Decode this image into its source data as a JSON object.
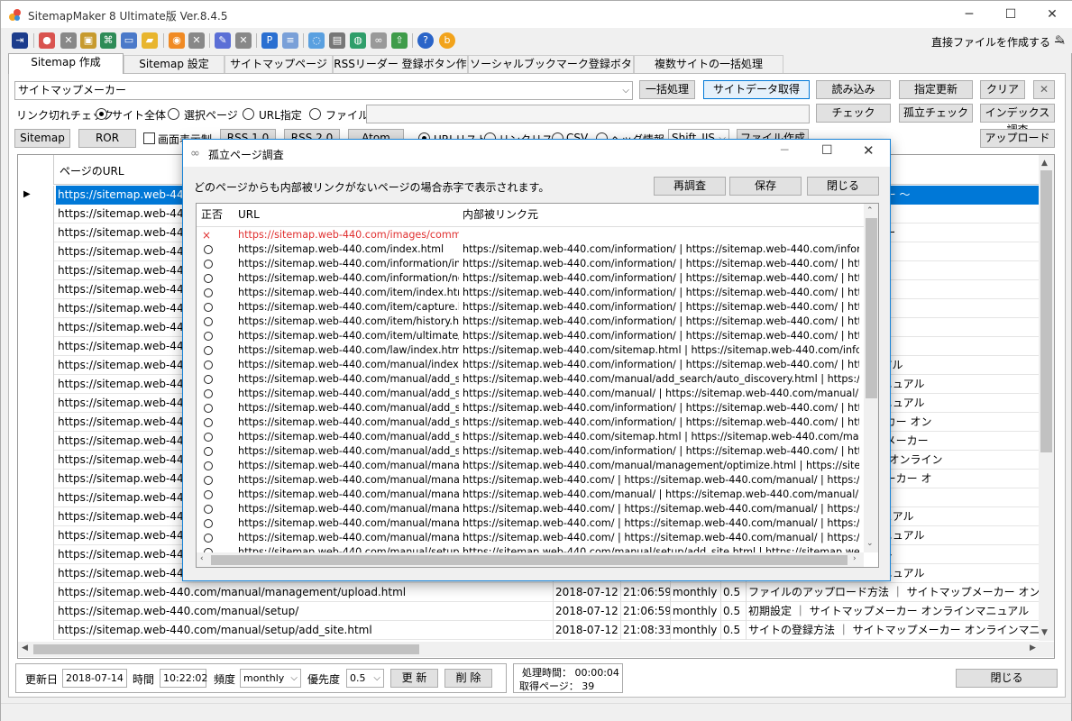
{
  "app": {
    "title": "SitemapMaker 8 Ultimate版  Ver.8.4.5",
    "direct_file_label": "直接ファイルを作成する ー"
  },
  "window_controls": {
    "minimize": "─",
    "maximize": "☐",
    "close": "✕"
  },
  "tabs": [
    {
      "label": "Sitemap 作成"
    },
    {
      "label": "Sitemap 設定"
    },
    {
      "label": "サイトマップページ作成"
    },
    {
      "label": "RSSリーダー 登録ボタン作成"
    },
    {
      "label": "ソーシャルブックマーク登録ボタン作成"
    },
    {
      "label": "複数サイトの一括処理"
    }
  ],
  "main": {
    "site_combo_value": "サイトマップメーカー",
    "batch_button": "一括処理",
    "get_site_data_button": "サイトデータ取得",
    "load_button": "読み込み",
    "update_button": "指定更新",
    "clear_button": "クリア",
    "link_check_label": "リンク切れチェック",
    "radio_whole_site": "サイト全体",
    "radio_selected_page": "選択ページ",
    "radio_url": "URL指定",
    "radio_file": "ファイル",
    "check_button": "チェック",
    "orphan_check_button": "孤立チェック",
    "index_check_button": "インデックス調査",
    "sitemap_button": "Sitemap",
    "ror_button": "ROR",
    "screen_display_label": "画面表示制",
    "rss10_button": "RSS 1.0",
    "rss20_button": "RSS 2.0",
    "atom_button": "Atom",
    "url_list_label": "URLリスト",
    "link_list_label": "リンクリスト",
    "csv_label": "CSV",
    "header_info_label": "ヘッダ情報",
    "encoding_value": "Shift_JIS",
    "file_create_button": "ファイル作成",
    "upload_button": "アップロード"
  },
  "grid": {
    "header_url": "ページのURL",
    "rows": [
      {
        "url": "https://sitemap.web-440.c",
        "date": "",
        "time": "",
        "freq": "",
        "prio": "",
        "title": "ット 〜 サイトマップメーカー 〜",
        "selected": true
      },
      {
        "url": "https://sitemap.web-440.c",
        "date": "",
        "time": "",
        "freq": "",
        "prio": "",
        "title": ""
      },
      {
        "url": "https://sitemap.web-440.c",
        "date": "",
        "time": "",
        "freq": "",
        "prio": "",
        "title": "いて ｜ サイトマップメーカー"
      },
      {
        "url": "https://sitemap.web-440.c",
        "date": "",
        "time": "",
        "freq": "",
        "prio": "",
        "title": "プメーカー"
      },
      {
        "url": "https://sitemap.web-440.c",
        "date": "",
        "time": "",
        "freq": "",
        "prio": "",
        "title": "プメーカー"
      },
      {
        "url": "https://sitemap.web-440.c",
        "date": "",
        "time": "",
        "freq": "",
        "prio": "",
        "title": "カー"
      },
      {
        "url": "https://sitemap.web-440.c",
        "date": "",
        "time": "",
        "freq": "",
        "prio": "",
        "title": ""
      },
      {
        "url": "https://sitemap.web-440.c",
        "date": "",
        "time": "",
        "freq": "",
        "prio": "",
        "title": "ー"
      },
      {
        "url": "https://sitemap.web-440.c",
        "date": "",
        "time": "",
        "freq": "",
        "prio": "",
        "title": "トマップメーカー"
      },
      {
        "url": "https://sitemap.web-440.c",
        "date": "",
        "time": "",
        "freq": "",
        "prio": "",
        "title": "メーカー オンラインマニュアル"
      },
      {
        "url": "https://sitemap.web-440.c",
        "date": "",
        "time": "",
        "freq": "",
        "prio": "",
        "title": "ップメーカー オンラインマニュアル"
      },
      {
        "url": "https://sitemap.web-440.c",
        "date": "",
        "time": "",
        "freq": "",
        "prio": "",
        "title": "ップメーカー オンラインマニュアル"
      },
      {
        "url": "https://sitemap.web-440.c",
        "date": "",
        "time": "",
        "freq": "",
        "prio": "",
        "title": "録方法 ｜ サイトマップメーカー オン"
      },
      {
        "url": "https://sitemap.web-440.c",
        "date": "",
        "time": "",
        "freq": "",
        "prio": "",
        "title": "の登録方法 ｜ サイトマップメーカー"
      },
      {
        "url": "https://sitemap.web-440.c",
        "date": "",
        "time": "",
        "freq": "",
        "prio": "",
        "title": "法 ｜ サイトマップメーカー オンライン"
      },
      {
        "url": "https://sitemap.web-440.c",
        "date": "",
        "time": "",
        "freq": "",
        "prio": "",
        "title": "登録方法 ｜ サイトマップメーカー オ"
      },
      {
        "url": "https://sitemap.web-440.c",
        "date": "",
        "time": "",
        "freq": "",
        "prio": "",
        "title": "カー オンラインマニュアル"
      },
      {
        "url": "https://sitemap.web-440.c",
        "date": "",
        "time": "",
        "freq": "",
        "prio": "",
        "title": "プメーカー オンラインマニュアル"
      },
      {
        "url": "https://sitemap.web-440.c",
        "date": "",
        "time": "",
        "freq": "",
        "prio": "",
        "title": "ップメーカー オンラインマニュアル"
      },
      {
        "url": "https://sitemap.web-440.c",
        "date": "",
        "time": "",
        "freq": "",
        "prio": "",
        "title": "ーカー オンラインマニュアル"
      },
      {
        "url": "https://sitemap.web-440.c",
        "date": "",
        "time": "",
        "freq": "",
        "prio": "",
        "title": "ップメーカー オンラインマニュアル"
      },
      {
        "url": "https://sitemap.web-440.com/manual/management/upload.html",
        "date": "2018-07-12",
        "time": "21:06:59",
        "freq": "monthly",
        "prio": "0.5",
        "title": "ファイルのアップロード方法 ｜ サイトマップメーカー オンラインマニュアル"
      },
      {
        "url": "https://sitemap.web-440.com/manual/setup/",
        "date": "2018-07-12",
        "time": "21:06:59",
        "freq": "monthly",
        "prio": "0.5",
        "title": "初期設定 ｜ サイトマップメーカー オンラインマニュアル"
      },
      {
        "url": "https://sitemap.web-440.com/manual/setup/add_site.html",
        "date": "2018-07-12",
        "time": "21:08:33",
        "freq": "monthly",
        "prio": "0.5",
        "title": "サイトの登録方法 ｜ サイトマップメーカー オンラインマニュアル"
      }
    ]
  },
  "bottom": {
    "updated_label": "更新日",
    "updated_value": "2018-07-14",
    "time_label": "時間",
    "time_value": "10:22:02",
    "freq_label": "頻度",
    "freq_value": "monthly",
    "priority_label": "優先度",
    "priority_value": "0.5",
    "update_button": "更 新",
    "delete_button": "削 除",
    "process_time": "処理時間： 00:00:04",
    "pages_fetched": "取得ページ： 39",
    "close_button": "閉じる"
  },
  "dialog": {
    "title": "孤立ページ調査",
    "info": "どのページからも内部被リンクがないページの場合赤字で表示されます。",
    "rescan_button": "再調査",
    "save_button": "保存",
    "close_button": "閉じる",
    "col_status": "正否",
    "col_url": "URL",
    "col_source": "内部被リンク元",
    "rows": [
      {
        "ok": false,
        "url": "https://sitemap.web-440.com/images/comm...",
        "source": ""
      },
      {
        "ok": true,
        "url": "https://sitemap.web-440.com/index.html",
        "source": "https://sitemap.web-440.com/information/ | https://sitemap.web-440.com/informati..."
      },
      {
        "ok": true,
        "url": "https://sitemap.web-440.com/information/in...",
        "source": "https://sitemap.web-440.com/information/ | https://sitemap.web-440.com/ | https:/..."
      },
      {
        "ok": true,
        "url": "https://sitemap.web-440.com/information/no...",
        "source": "https://sitemap.web-440.com/information/ | https://sitemap.web-440.com/ | https:/..."
      },
      {
        "ok": true,
        "url": "https://sitemap.web-440.com/item/index.html",
        "source": "https://sitemap.web-440.com/information/ | https://sitemap.web-440.com/ | https:/..."
      },
      {
        "ok": true,
        "url": "https://sitemap.web-440.com/item/capture.h",
        "source": "https://sitemap.web-440.com/information/ | https://sitemap.web-440.com/ | https:/..."
      },
      {
        "ok": true,
        "url": "https://sitemap.web-440.com/item/history.ht",
        "source": "https://sitemap.web-440.com/information/ | https://sitemap.web-440.com/ | https:/..."
      },
      {
        "ok": true,
        "url": "https://sitemap.web-440.com/item/ultimate/...",
        "source": "https://sitemap.web-440.com/information/ | https://sitemap.web-440.com/ | https:/..."
      },
      {
        "ok": true,
        "url": "https://sitemap.web-440.com/law/index.html",
        "source": "https://sitemap.web-440.com/sitemap.html | https://sitemap.web-440.com/informati..."
      },
      {
        "ok": true,
        "url": "https://sitemap.web-440.com/manual/index.h",
        "source": "https://sitemap.web-440.com/information/ | https://sitemap.web-440.com/ | https:/..."
      },
      {
        "ok": true,
        "url": "https://sitemap.web-440.com/manual/add_se...",
        "source": "https://sitemap.web-440.com/manual/add_search/auto_discovery.html | https://site..."
      },
      {
        "ok": true,
        "url": "https://sitemap.web-440.com/manual/add_se...",
        "source": "https://sitemap.web-440.com/manual/ | https://sitemap.web-440.com/manual/ | htt..."
      },
      {
        "ok": true,
        "url": "https://sitemap.web-440.com/manual/add_se...",
        "source": "https://sitemap.web-440.com/information/ | https://sitemap.web-440.com/ | https:/..."
      },
      {
        "ok": true,
        "url": "https://sitemap.web-440.com/manual/add_se...",
        "source": "https://sitemap.web-440.com/information/ | https://sitemap.web-440.com/ | https:/..."
      },
      {
        "ok": true,
        "url": "https://sitemap.web-440.com/manual/add_se...",
        "source": "https://sitemap.web-440.com/sitemap.html | https://sitemap.web-440.com/manual/..."
      },
      {
        "ok": true,
        "url": "https://sitemap.web-440.com/manual/add_se...",
        "source": "https://sitemap.web-440.com/information/ | https://sitemap.web-440.com/ | https:/..."
      },
      {
        "ok": true,
        "url": "https://sitemap.web-440.com/manual/manage...",
        "source": "https://sitemap.web-440.com/manual/management/optimize.html | https://sitemap...."
      },
      {
        "ok": true,
        "url": "https://sitemap.web-440.com/manual/manage...",
        "source": "https://sitemap.web-440.com/ | https://sitemap.web-440.com/manual/ | https://sit..."
      },
      {
        "ok": true,
        "url": "https://sitemap.web-440.com/manual/manage...",
        "source": "https://sitemap.web-440.com/manual/ | https://sitemap.web-440.com/manual/ | htt..."
      },
      {
        "ok": true,
        "url": "https://sitemap.web-440.com/manual/manage...",
        "source": "https://sitemap.web-440.com/ | https://sitemap.web-440.com/manual/ | https://sit..."
      },
      {
        "ok": true,
        "url": "https://sitemap.web-440.com/manual/manage...",
        "source": "https://sitemap.web-440.com/ | https://sitemap.web-440.com/manual/ | https://sit..."
      },
      {
        "ok": true,
        "url": "https://sitemap.web-440.com/manual/manage...",
        "source": "https://sitemap.web-440.com/ | https://sitemap.web-440.com/manual/ | https://sit..."
      },
      {
        "ok": true,
        "url": "https://sitemap.web-440.com/manual/setup/...",
        "source": "https://sitemap.web-440.com/manual/setup/add_site.html | https://sitemap.web-44..."
      }
    ]
  }
}
